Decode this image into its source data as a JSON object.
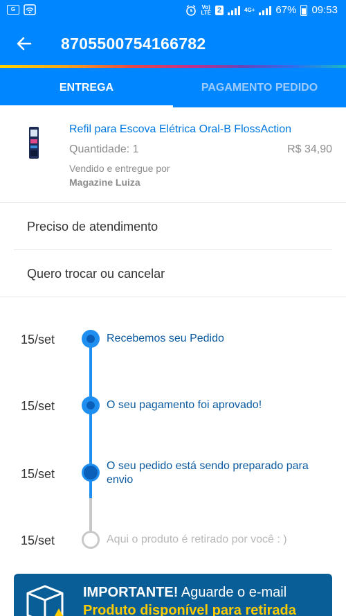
{
  "status_bar": {
    "network_badge": "2",
    "lte_top": "Vo)",
    "lte_bottom": "LTE",
    "signal_label": "4G+",
    "battery": "67%",
    "time": "09:53"
  },
  "header": {
    "title": "8705500754166782",
    "back_icon": "arrow-left-icon"
  },
  "tabs": [
    {
      "label": "ENTREGA",
      "active": true
    },
    {
      "label": "PAGAMENTO PEDIDO",
      "active": false
    }
  ],
  "product": {
    "name": "Refil para Escova Elétrica Oral-B FlossAction",
    "quantity": "Quantidade: 1",
    "price": "R$ 34,90",
    "sold_by_label": "Vendido e entregue por",
    "seller": "Magazine Luiza"
  },
  "menu": [
    {
      "label": "Preciso de atendimento"
    },
    {
      "label": "Quero trocar ou cancelar"
    }
  ],
  "timeline": [
    {
      "date": "15/set",
      "label": "Recebemos seu Pedido",
      "state": "done"
    },
    {
      "date": "15/set",
      "label": "O seu pagamento foi aprovado!",
      "state": "done"
    },
    {
      "date": "15/set",
      "label": "O seu pedido está sendo preparado para envio",
      "state": "current"
    },
    {
      "date": "15/set",
      "label": "Aqui o produto é retirado por você : )",
      "state": "pending"
    }
  ],
  "notice": {
    "title_bold": "IMPORTANTE!",
    "title_rest": " Aguarde o e-mail",
    "subtitle": "Produto disponível para retirada"
  },
  "colors": {
    "primary": "#0086ff",
    "link": "#0078e0",
    "timeline_active": "#1f8ef1",
    "notice_bg": "#0a5e98",
    "notice_accent": "#ffcc00"
  }
}
